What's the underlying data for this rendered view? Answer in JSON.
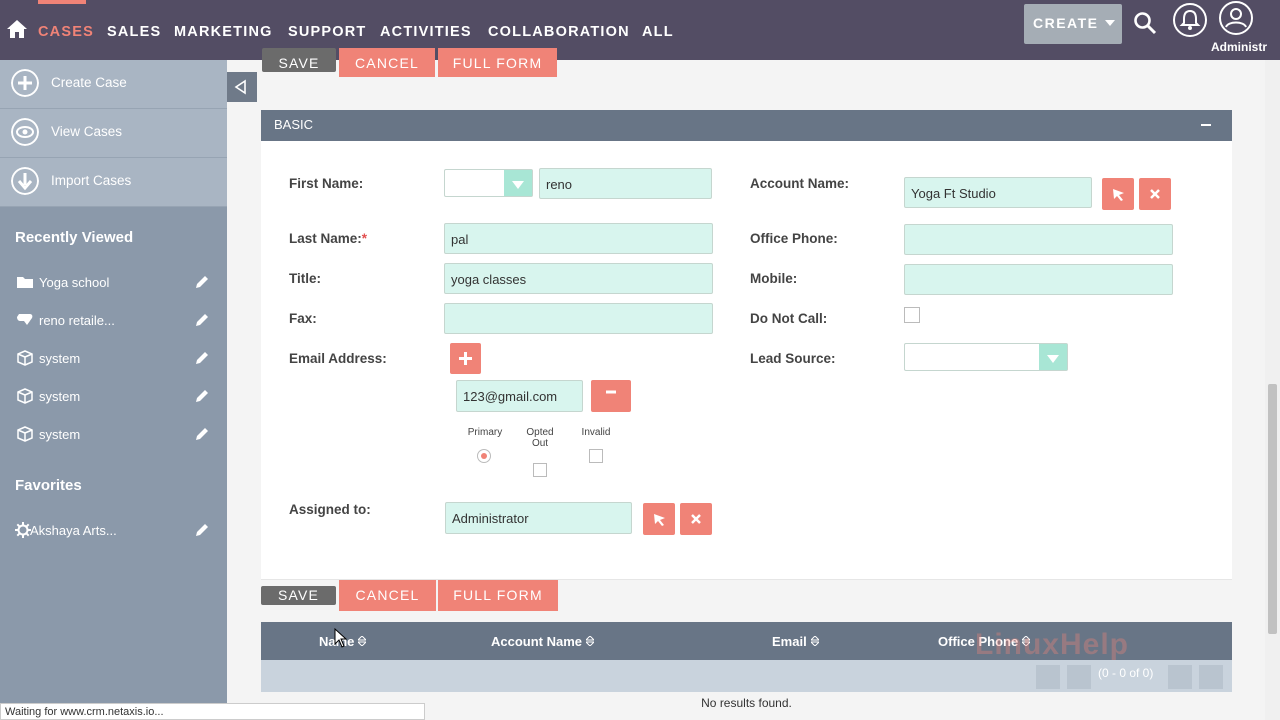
{
  "nav": {
    "items": [
      "CASES",
      "SALES",
      "MARKETING",
      "SUPPORT",
      "ACTIVITIES",
      "COLLABORATION",
      "ALL"
    ],
    "create_label": "CREATE",
    "user_label": "Administr"
  },
  "sidebar": {
    "actions": [
      "Create Case",
      "View Cases",
      "Import Cases"
    ],
    "recently_viewed_title": "Recently Viewed",
    "recently_viewed": [
      "Yoga school",
      "reno retaile...",
      "system",
      "system",
      "system"
    ],
    "favorites_title": "Favorites",
    "favorites": [
      "Akshaya Arts..."
    ]
  },
  "buttons": {
    "save": "SAVE",
    "cancel": "CANCEL",
    "full_form": "FULL FORM"
  },
  "panel": {
    "title": "BASIC"
  },
  "form": {
    "first_name_label": "First Name:",
    "first_name_value": "reno",
    "last_name_label": "Last Name:",
    "last_name_required": "*",
    "last_name_value": "pal",
    "title_label": "Title:",
    "title_value": "yoga classes",
    "fax_label": "Fax:",
    "fax_value": "",
    "email_label": "Email Address:",
    "email_value": "123@gmail.com",
    "primary_label": "Primary",
    "opted_label_1": "Opted",
    "opted_label_2": "Out",
    "invalid_label": "Invalid",
    "assigned_label": "Assigned to:",
    "assigned_value": "Administrator",
    "account_name_label": "Account Name:",
    "account_name_value": "Yoga Ft Studio",
    "office_phone_label": "Office Phone:",
    "office_phone_value": "",
    "mobile_label": "Mobile:",
    "mobile_value": "",
    "do_not_call_label": "Do Not Call:",
    "lead_source_label": "Lead Source:"
  },
  "results": {
    "columns": [
      "Name",
      "Account Name",
      "Email",
      "Office Phone"
    ],
    "count": "(0 - 0 of 0)",
    "empty": "No results found."
  },
  "status": "Waiting for www.crm.netaxis.io...",
  "watermark": "LinuxHelp"
}
